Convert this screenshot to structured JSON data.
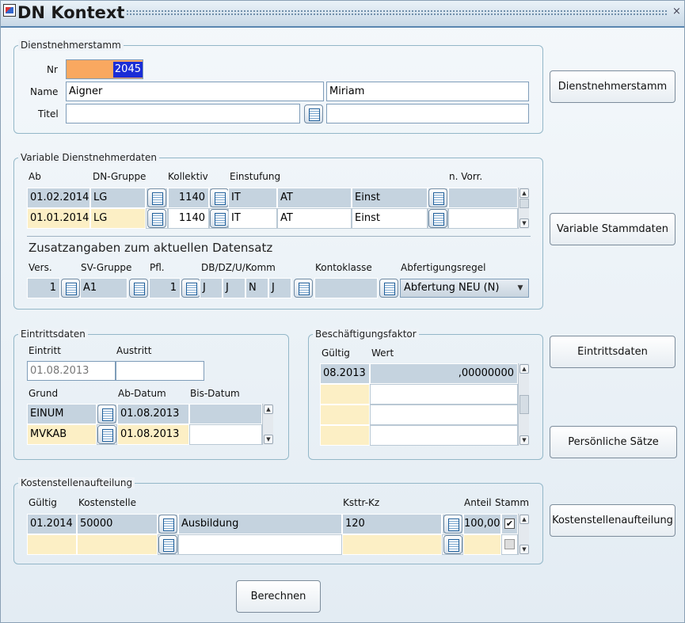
{
  "window": {
    "title": "DN Kontext",
    "close": "×"
  },
  "stamm": {
    "legend": "Dienstnehmerstamm",
    "nr_label": "Nr",
    "nr_value": "2045",
    "name_label": "Name",
    "last_name": "Aigner",
    "first_name": "Miriam",
    "titel_label": "Titel",
    "titel_value": "",
    "titel_value2": ""
  },
  "var": {
    "legend": "Variable Dienstnehmerdaten",
    "headers": {
      "ab": "Ab",
      "dn_gruppe": "DN-Gruppe",
      "kollektiv": "Kollektiv",
      "einstufung": "Einstufung",
      "n_vorr": "n. Vorr."
    },
    "rows": [
      {
        "ab": "01.02.2014",
        "dn_gruppe": "LG",
        "kollektiv": "1140",
        "einst1": "IT",
        "einst2": "AT",
        "einst3": "Einst",
        "n_vorr": ""
      },
      {
        "ab": "01.01.2014",
        "dn_gruppe": "LG",
        "kollektiv": "1140",
        "einst1": "IT",
        "einst2": "AT",
        "einst3": "Einst",
        "n_vorr": ""
      }
    ],
    "zusatz_title": "Zusatzangaben zum aktuellen Datensatz",
    "zusatz_headers": {
      "vers": "Vers.",
      "sv": "SV-Gruppe",
      "pfl": "Pfl.",
      "db": "DB/DZ/U/Komm",
      "konto": "Kontoklasse",
      "abf": "Abfertigungsregel"
    },
    "zusatz": {
      "vers": "1",
      "sv": "A1",
      "pfl": "1",
      "db1": "J",
      "db2": "J",
      "db3": "N",
      "db4": "J",
      "konto": "",
      "abf": "Abfertung NEU (N)"
    }
  },
  "eintritt": {
    "legend": "Eintrittsdaten",
    "eintritt_label": "Eintritt",
    "austritt_label": "Austritt",
    "eintritt_value": "01.08.2013",
    "austritt_value": "",
    "headers": {
      "grund": "Grund",
      "ab": "Ab-Datum",
      "bis": "Bis-Datum"
    },
    "rows": [
      {
        "grund": "EINUM",
        "ab": "01.08.2013",
        "bis": ""
      },
      {
        "grund": "MVKAB",
        "ab": "01.08.2013",
        "bis": ""
      }
    ]
  },
  "besch": {
    "legend": "Beschäftigungsfaktor",
    "headers": {
      "gueltig": "Gültig",
      "wert": "Wert"
    },
    "rows": [
      {
        "gueltig": "08.2013",
        "wert": ",00000000"
      },
      {
        "gueltig": "",
        "wert": ""
      },
      {
        "gueltig": "",
        "wert": ""
      },
      {
        "gueltig": "",
        "wert": ""
      }
    ]
  },
  "kst": {
    "legend": "Kostenstellenaufteilung",
    "headers": {
      "gueltig": "Gültig",
      "kst": "Kostenstelle",
      "kz": "Ksttr-Kz",
      "anteil": "Anteil",
      "stamm": "Stamm"
    },
    "rows": [
      {
        "gueltig": "01.2014",
        "kst": "50000",
        "name": "Ausbildung",
        "kz": "120",
        "anteil": "100,00",
        "stamm": "✔"
      },
      {
        "gueltig": "",
        "kst": "",
        "name": "",
        "kz": "",
        "anteil": "",
        "stamm": ""
      }
    ]
  },
  "buttons": {
    "dienstnehmerstamm": "Dienstnehmerstamm",
    "variable": "Variable Stammdaten",
    "eintritt": "Eintrittsdaten",
    "persoenlich": "Persönliche Sätze",
    "kst": "Kostenstellenaufteilung",
    "berechnen": "Berechnen"
  },
  "colors": {
    "title_underline": "#5a86b0",
    "row_selected": "#c5d3df",
    "row_current": "#fcefc5",
    "nr_field": "#f9a860",
    "nr_value_bg": "#1a2dd6"
  }
}
